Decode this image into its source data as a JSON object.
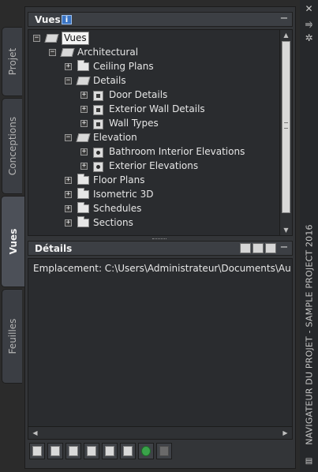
{
  "palette": {
    "title": "NAVIGATEUR DU PROJET - SAMPLE PROJECT 2016",
    "controls": {
      "close_glyph": "✕",
      "pin_glyph": "⥤",
      "settings_glyph": "✲"
    }
  },
  "tabs": [
    {
      "label": "Projet",
      "active": false
    },
    {
      "label": "Conceptions",
      "active": false
    },
    {
      "label": "Vues",
      "active": true
    },
    {
      "label": "Feuilles",
      "active": false
    }
  ],
  "views_section": {
    "title": "Vues",
    "info_glyph": "i",
    "collapse_glyph": "−",
    "tree": [
      {
        "label": "Vues",
        "level": 0,
        "expander": "−",
        "icon": "folder-open-icon",
        "selected": true
      },
      {
        "label": "Architectural",
        "level": 1,
        "expander": "−",
        "icon": "folder-open-icon"
      },
      {
        "label": "Ceiling Plans",
        "level": 2,
        "expander": "+",
        "icon": "folder-icon"
      },
      {
        "label": "Details",
        "level": 2,
        "expander": "−",
        "icon": "folder-open-icon"
      },
      {
        "label": "Door Details",
        "level": 3,
        "expander": "+",
        "icon": "detail-view-icon"
      },
      {
        "label": "Exterior Wall Details",
        "level": 3,
        "expander": "+",
        "icon": "detail-view-icon"
      },
      {
        "label": "Wall Types",
        "level": 3,
        "expander": "+",
        "icon": "detail-view-icon"
      },
      {
        "label": "Elevation",
        "level": 2,
        "expander": "−",
        "icon": "folder-open-icon"
      },
      {
        "label": "Bathroom Interior Elevations",
        "level": 3,
        "expander": "+",
        "icon": "elevation-view-icon"
      },
      {
        "label": "Exterior Elevations",
        "level": 3,
        "expander": "+",
        "icon": "elevation-view-icon"
      },
      {
        "label": "Floor Plans",
        "level": 2,
        "expander": "+",
        "icon": "folder-icon"
      },
      {
        "label": "Isometric 3D",
        "level": 2,
        "expander": "+",
        "icon": "folder-icon"
      },
      {
        "label": "Schedules",
        "level": 2,
        "expander": "+",
        "icon": "folder-icon"
      },
      {
        "label": "Sections",
        "level": 2,
        "expander": "+",
        "icon": "folder-icon"
      }
    ]
  },
  "details_section": {
    "title": "Détails",
    "collapse_glyph": "−",
    "location_text": "Emplacement: C:\\Users\\Administrateur\\Documents\\Autodesk\\"
  },
  "toolbar": [
    {
      "name": "add-view-icon"
    },
    {
      "name": "add-category-icon"
    },
    {
      "name": "regenerate-icon"
    },
    {
      "name": "view-properties-icon"
    },
    {
      "name": "cut-icon"
    },
    {
      "name": "callout-icon"
    },
    {
      "name": "refresh-icon",
      "green": true
    },
    {
      "name": "remove-icon",
      "disabled": true
    }
  ],
  "colors": {
    "panel": "#333538",
    "tree_bg": "#2a2c2f",
    "selection_bg": "#f4f4f4",
    "refresh_green": "#3aa34a"
  }
}
